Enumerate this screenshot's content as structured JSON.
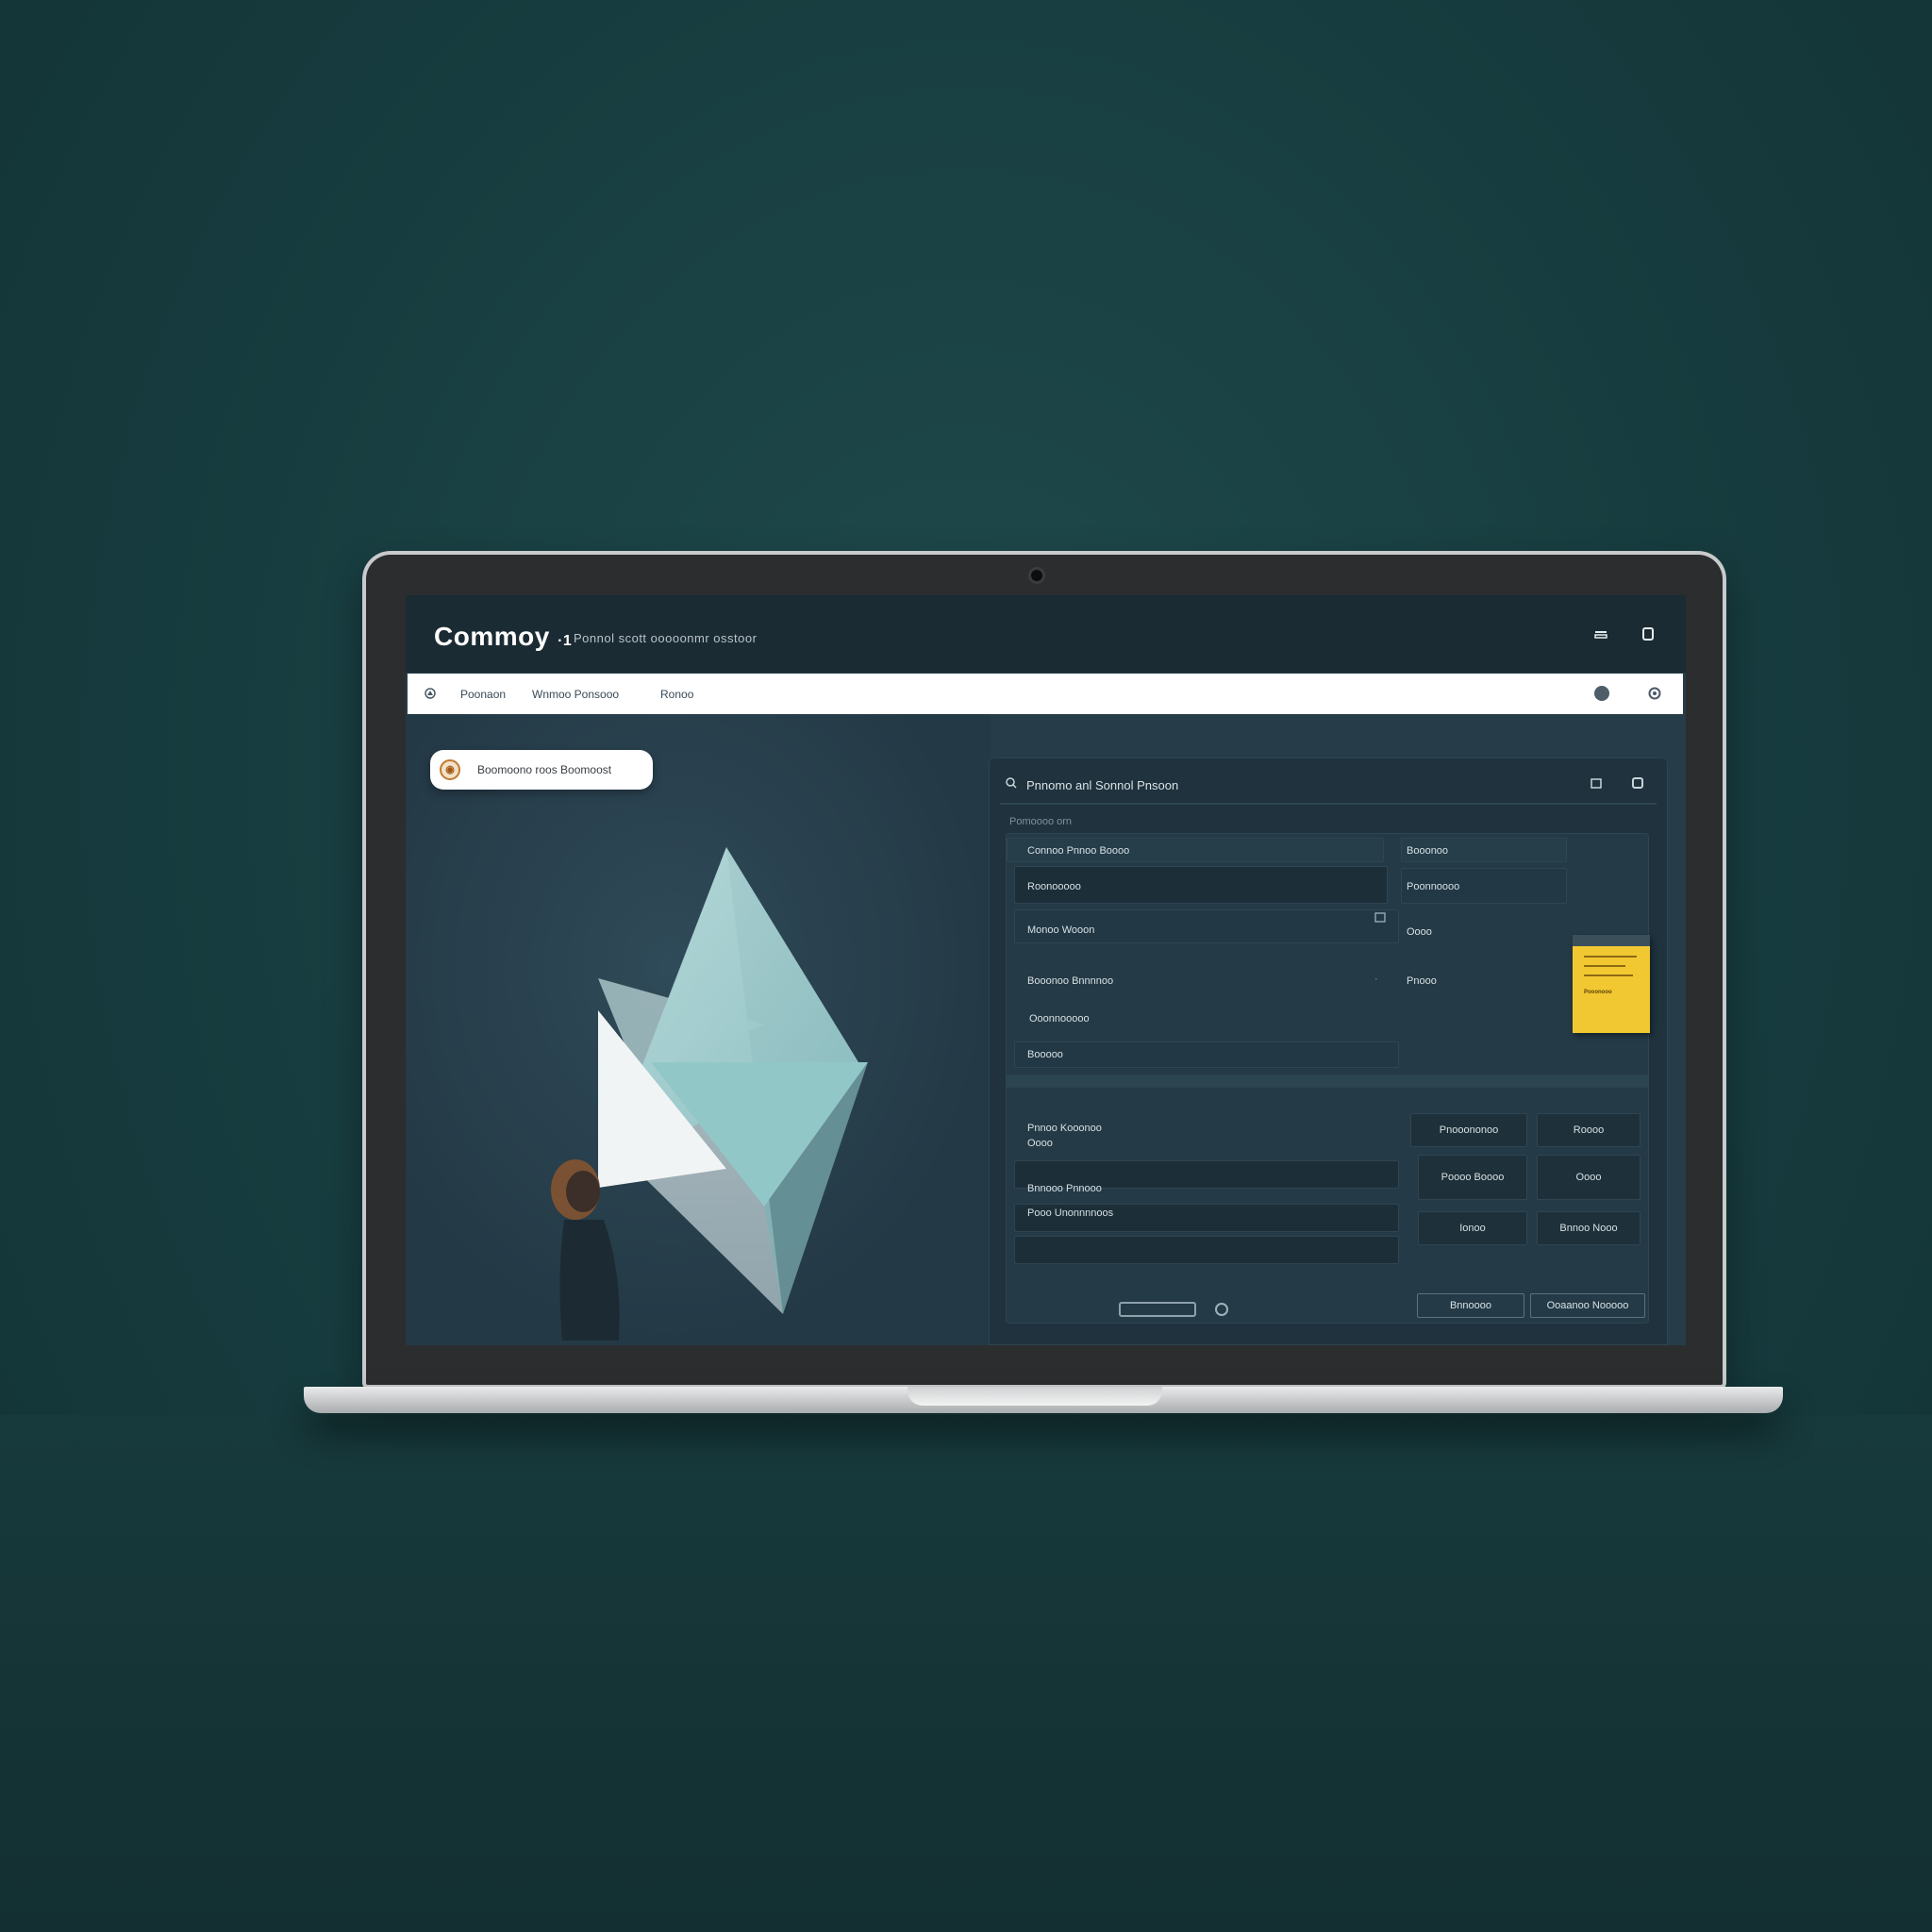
{
  "app": {
    "brand": "Commoy",
    "brand_suffix": "·1",
    "subtitle": "Ponnol scott ooooonmr osstoor"
  },
  "topbar_icons": [
    "minimize-icon",
    "window-icon"
  ],
  "nav": {
    "items": [
      "Poonaon",
      "Wnmoo Ponsooo",
      "Ronoo"
    ],
    "right_icons": [
      "user-icon",
      "settings-icon"
    ]
  },
  "hero": {
    "pill_text": "Boomoono roos Boomoost"
  },
  "panel": {
    "title": "Pnnomo anl Sonnol Pnsoon",
    "subheading": "Pomoooo orn",
    "form_left": {
      "field1_label": "Connoo Pnnoo Boooo",
      "field2_label": "Roonooooo",
      "field3_label": "Monoo Wooon",
      "field4_label": "Booonoo Bnnnnoo",
      "field5_label": "Ooonnooooo",
      "field6_label": "Booooo"
    },
    "form_right": {
      "label1": "Booonoo",
      "label2": "Poonnoooo",
      "label3": "Oooo",
      "label4": "Pnooo"
    },
    "sticky_note_text": "Pooonooo",
    "lower_left": {
      "label1": "Pnnoo Kooonoo",
      "label1_sub": "Oooo",
      "label2": "Bnnooo Pnnooo",
      "label3": "Pooo Unonnnnoos"
    },
    "tiles": [
      "Pnooononoo",
      "Roooo",
      "Poooo Boooo",
      "Oooo",
      "Ionoo",
      "Bnnoo Nooo"
    ],
    "footer_buttons": [
      "Bnnoooo",
      "Ooaanoo Nooooo"
    ]
  },
  "colors": {
    "background": "#173c3f",
    "screen_bg": "#263c48",
    "accent_yellow": "#f2c832",
    "triangle_teal": "#8fc4c6"
  }
}
